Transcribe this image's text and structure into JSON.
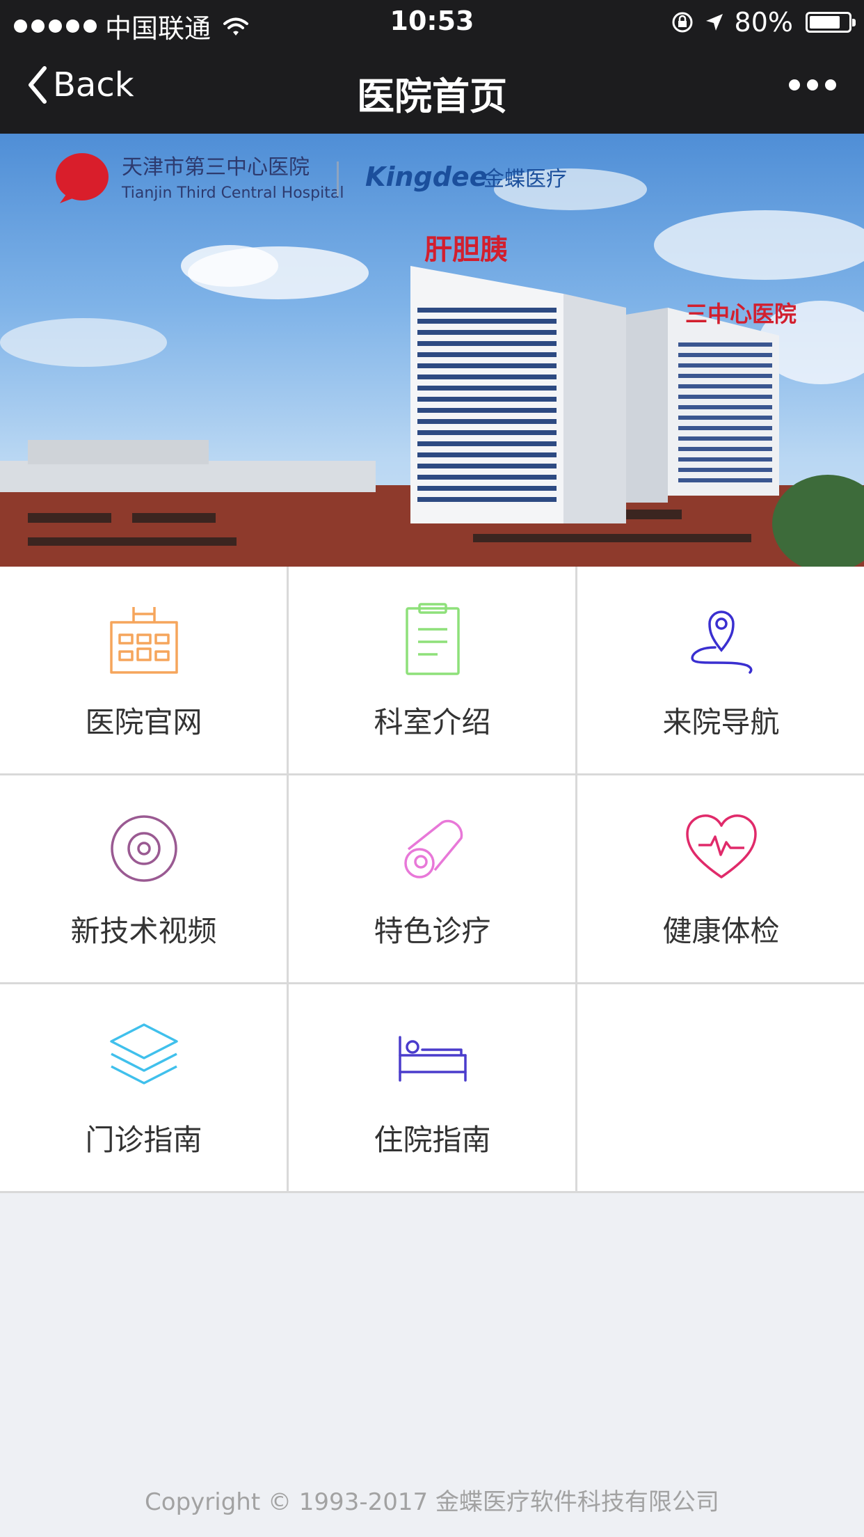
{
  "status_bar": {
    "carrier": "中国联通",
    "time": "10:53",
    "battery": "80%",
    "battery_level": 0.8
  },
  "nav": {
    "back_label": "Back",
    "title": "医院首页"
  },
  "banner": {
    "hospital_name_cn": "天津市第三中心医院",
    "hospital_name_en": "Tianjin Third Central Hospital",
    "partner_logo": "Kingdee",
    "partner_name_cn": "金蝶医疗",
    "roof_sign_1": "肝胆胰",
    "roof_sign_2": "三中心医院"
  },
  "menu": [
    {
      "label": "医院官网",
      "icon": "hospital-building-icon",
      "color": "#f5a55c"
    },
    {
      "label": "科室介绍",
      "icon": "clipboard-icon",
      "color": "#8ee07a"
    },
    {
      "label": "来院导航",
      "icon": "location-pin-icon",
      "color": "#3a2fd0"
    },
    {
      "label": "新技术视频",
      "icon": "disc-icon",
      "color": "#9a5a92"
    },
    {
      "label": "特色诊疗",
      "icon": "scroll-icon",
      "color": "#e878d8"
    },
    {
      "label": "健康体检",
      "icon": "heartbeat-icon",
      "color": "#e02a6a"
    },
    {
      "label": "门诊指南",
      "icon": "layers-icon",
      "color": "#40c0ec"
    },
    {
      "label": "住院指南",
      "icon": "bed-icon",
      "color": "#4a3ccc"
    }
  ],
  "footer": {
    "copyright": "Copyright © 1993-2017 金蝶医疗软件科技有限公司"
  }
}
